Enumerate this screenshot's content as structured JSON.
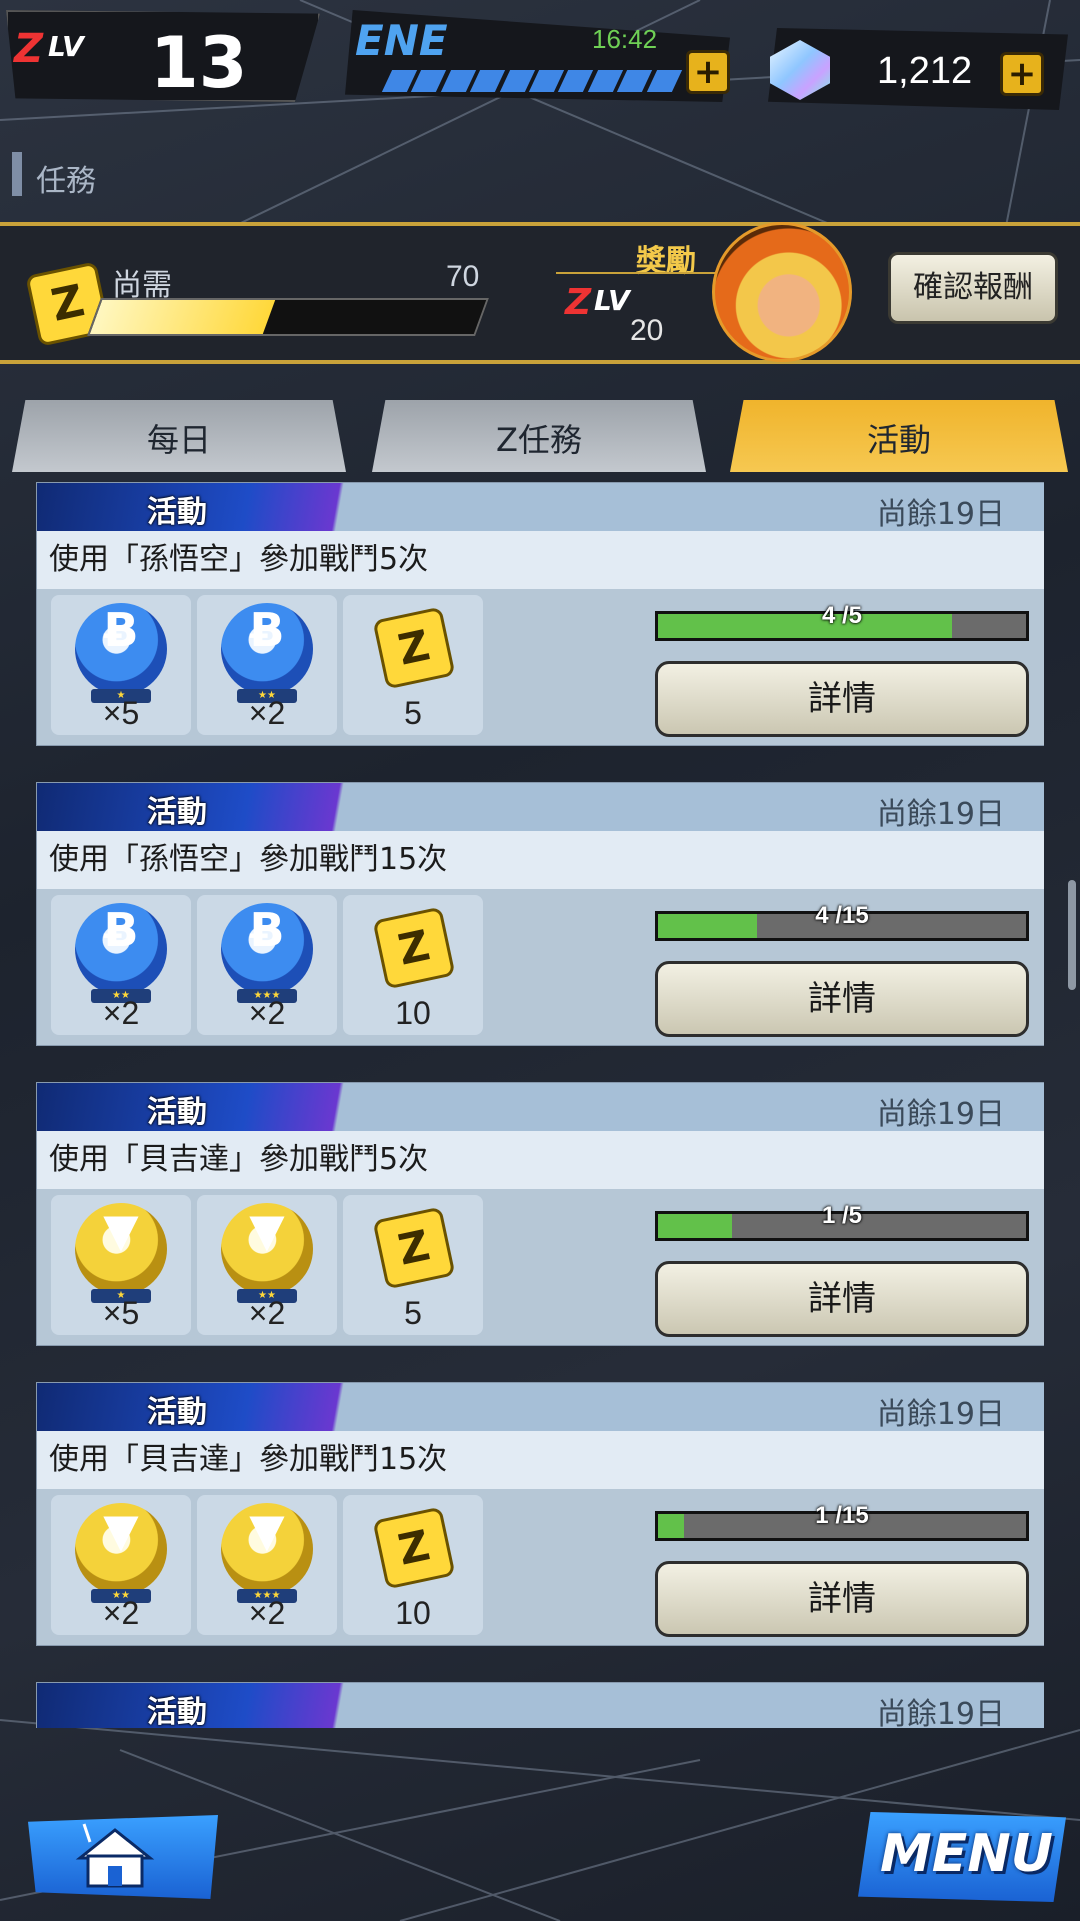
{
  "header": {
    "zlv_z": "Z",
    "zlv_lv": "LV",
    "zlv_value": "13",
    "energy_label": "ENE",
    "energy_timer": "16:42",
    "energy_segments": 10,
    "gem_count": "1,212",
    "add_symbol": "+"
  },
  "section": {
    "title": "任務"
  },
  "reward_band": {
    "z_symbol": "Z",
    "need_label": "尚需",
    "need_value": "70",
    "need_progress": 0.45,
    "reward_label": "獎勵",
    "reward_z": "Z",
    "reward_lv": "LV",
    "reward_level": "20",
    "confirm_label": "確認報酬"
  },
  "tabs": [
    {
      "label": "每日",
      "active": false
    },
    {
      "label": "Z任務",
      "active": false
    },
    {
      "label": "活動",
      "active": true
    }
  ],
  "tasks": [
    {
      "badge": "活動",
      "days_left": "尚餘19日",
      "title": "使用「孫悟空」參加戰鬥5次",
      "rewards": [
        {
          "icon": "blue-orb-icon",
          "color": "blue",
          "stars": "★",
          "qty": "×5"
        },
        {
          "icon": "blue-orb-icon",
          "color": "blue",
          "stars": "★★",
          "qty": "×2"
        }
      ],
      "z_reward": "5",
      "progress_text": "4 /5",
      "progress": 0.8,
      "detail_label": "詳情"
    },
    {
      "badge": "活動",
      "days_left": "尚餘19日",
      "title": "使用「孫悟空」參加戰鬥15次",
      "rewards": [
        {
          "icon": "blue-orb-icon",
          "color": "blue",
          "stars": "★★",
          "qty": "×2"
        },
        {
          "icon": "blue-orb-icon",
          "color": "blue",
          "stars": "★★★",
          "qty": "×2"
        }
      ],
      "z_reward": "10",
      "progress_text": "4 /15",
      "progress": 0.27,
      "detail_label": "詳情"
    },
    {
      "badge": "活動",
      "days_left": "尚餘19日",
      "title": "使用「貝吉達」參加戰鬥5次",
      "rewards": [
        {
          "icon": "gold-orb-icon",
          "color": "gold",
          "stars": "★",
          "qty": "×5"
        },
        {
          "icon": "gold-orb-icon",
          "color": "gold",
          "stars": "★★",
          "qty": "×2"
        }
      ],
      "z_reward": "5",
      "progress_text": "1 /5",
      "progress": 0.2,
      "detail_label": "詳情"
    },
    {
      "badge": "活動",
      "days_left": "尚餘19日",
      "title": "使用「貝吉達」參加戰鬥15次",
      "rewards": [
        {
          "icon": "gold-orb-icon",
          "color": "gold",
          "stars": "★★",
          "qty": "×2"
        },
        {
          "icon": "gold-orb-icon",
          "color": "gold",
          "stars": "★★★",
          "qty": "×2"
        }
      ],
      "z_reward": "10",
      "progress_text": "1 /15",
      "progress": 0.07,
      "detail_label": "詳情"
    },
    {
      "badge": "活動",
      "days_left": "尚餘19日",
      "title": "",
      "rewards": [],
      "z_reward": "",
      "progress_text": "",
      "progress": 0,
      "detail_label": "",
      "partial": true
    }
  ],
  "bottom": {
    "home_icon": "home-icon",
    "menu_label": "MENU"
  },
  "colors": {
    "accent_gold": "#f0b42c",
    "progress_green": "#62c14a",
    "energy_blue": "#3f87e6"
  }
}
